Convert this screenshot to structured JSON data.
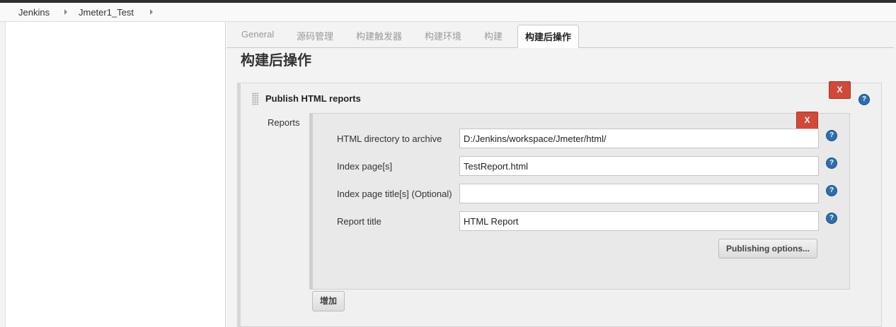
{
  "breadcrumb": {
    "items": [
      "Jenkins",
      "Jmeter1_Test"
    ]
  },
  "tabs": [
    {
      "label": "General"
    },
    {
      "label": "源码管理"
    },
    {
      "label": "构建触发器"
    },
    {
      "label": "构建环境"
    },
    {
      "label": "构建"
    },
    {
      "label": "构建后操作",
      "active": true
    }
  ],
  "section": {
    "title": "构建后操作"
  },
  "publisher": {
    "title": "Publish HTML reports",
    "delete_label": "X",
    "reports_label": "Reports",
    "report": {
      "delete_label": "X",
      "fields": [
        {
          "label": "HTML directory to archive",
          "value": "D:/Jenkins/workspace/Jmeter/html/"
        },
        {
          "label": "Index page[s]",
          "value": "TestReport.html"
        },
        {
          "label": "Index page title[s] (Optional)",
          "value": ""
        },
        {
          "label": "Report title",
          "value": "HTML Report"
        }
      ],
      "publishing_options_label": "Publishing options..."
    },
    "add_label": "增加"
  },
  "help_glyph": "?",
  "colors": {
    "delete_button": "#d24939",
    "help_icon": "#2a6fb1",
    "panel_background": "#f3f3f3"
  }
}
